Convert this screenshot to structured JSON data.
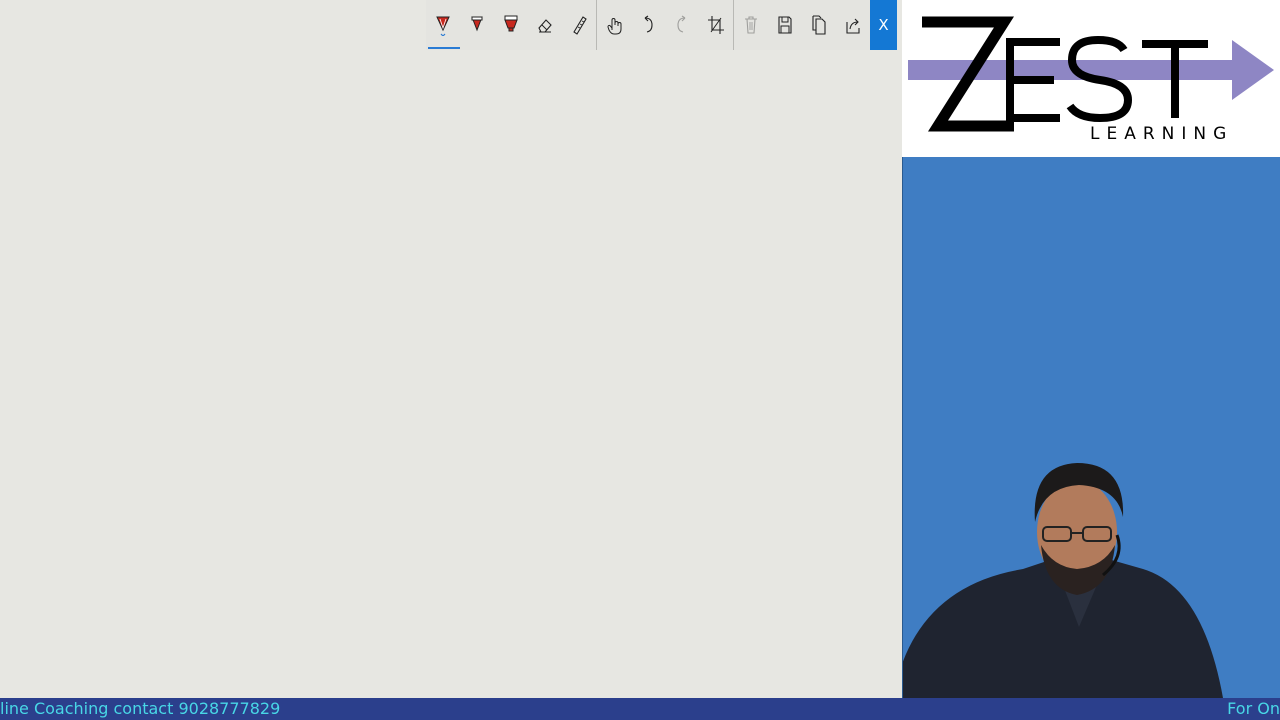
{
  "toolbar": {
    "tools": [
      {
        "name": "ballpoint-pen-icon",
        "active": true
      },
      {
        "name": "pencil-icon"
      },
      {
        "name": "highlighter-icon"
      },
      {
        "name": "eraser-icon"
      },
      {
        "name": "ruler-icon"
      },
      {
        "name": "touch-writing-icon"
      },
      {
        "name": "undo-icon"
      },
      {
        "name": "redo-icon",
        "disabled": true
      },
      {
        "name": "crop-icon"
      },
      {
        "name": "delete-icon",
        "disabled": true
      },
      {
        "name": "save-icon"
      },
      {
        "name": "copy-icon"
      },
      {
        "name": "share-icon"
      }
    ],
    "close_label": "X",
    "colors": {
      "accent": "#1478d4",
      "pen_red": "#c8281e"
    }
  },
  "logo": {
    "word": "ZEST",
    "tagline": "LEARNING",
    "arrow_color": "#8e86c4"
  },
  "presenter": {
    "background": "#3f7dc3"
  },
  "ticker": {
    "left_text": "line Coaching contact 9028777829",
    "right_text": "For On",
    "text_color": "#48d7e6",
    "bg_color": "#2b3f8c"
  }
}
